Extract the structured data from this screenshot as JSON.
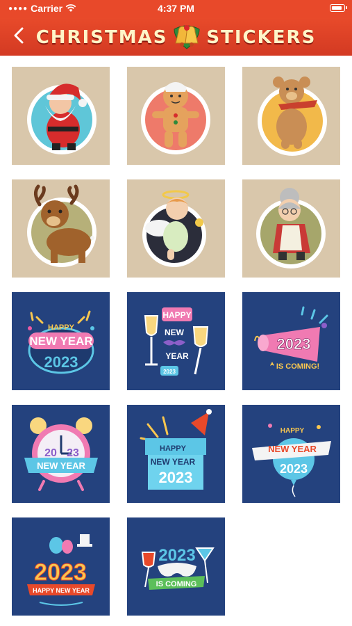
{
  "status": {
    "carrier": "Carrier",
    "time": "4:37 PM"
  },
  "header": {
    "title_left": "CHRISTMAS",
    "title_right": "STICKERS"
  },
  "stickers": [
    {
      "id": "santa",
      "type": "xmas"
    },
    {
      "id": "gingerbread",
      "type": "xmas"
    },
    {
      "id": "teddy-bear",
      "type": "xmas"
    },
    {
      "id": "reindeer",
      "type": "xmas"
    },
    {
      "id": "angel",
      "type": "xmas"
    },
    {
      "id": "grandma",
      "type": "xmas"
    },
    {
      "id": "new-year-2023-confetti",
      "type": "ny",
      "texts": [
        "HAPPY",
        "NEW YEAR",
        "2023"
      ]
    },
    {
      "id": "new-year-glasses",
      "type": "ny",
      "texts": [
        "HAPPY",
        "NEW",
        "YEAR",
        "2023"
      ]
    },
    {
      "id": "2023-is-coming-horn",
      "type": "ny",
      "texts": [
        "2023",
        "IS COMING!"
      ]
    },
    {
      "id": "new-year-alarm-clock",
      "type": "ny",
      "texts": [
        "20",
        "23",
        "NEW YEAR"
      ]
    },
    {
      "id": "new-year-gift-box",
      "type": "ny",
      "texts": [
        "HAPPY",
        "NEW YEAR",
        "2023"
      ]
    },
    {
      "id": "new-year-balloon",
      "type": "ny",
      "texts": [
        "HAPPY",
        "NEW YEAR",
        "2023"
      ]
    },
    {
      "id": "happy-new-year-balloons",
      "type": "ny",
      "texts": [
        "2023",
        "HAPPY NEW YEAR"
      ]
    },
    {
      "id": "2023-is-coming-mask",
      "type": "ny",
      "texts": [
        "2023",
        "IS COMING"
      ]
    }
  ]
}
